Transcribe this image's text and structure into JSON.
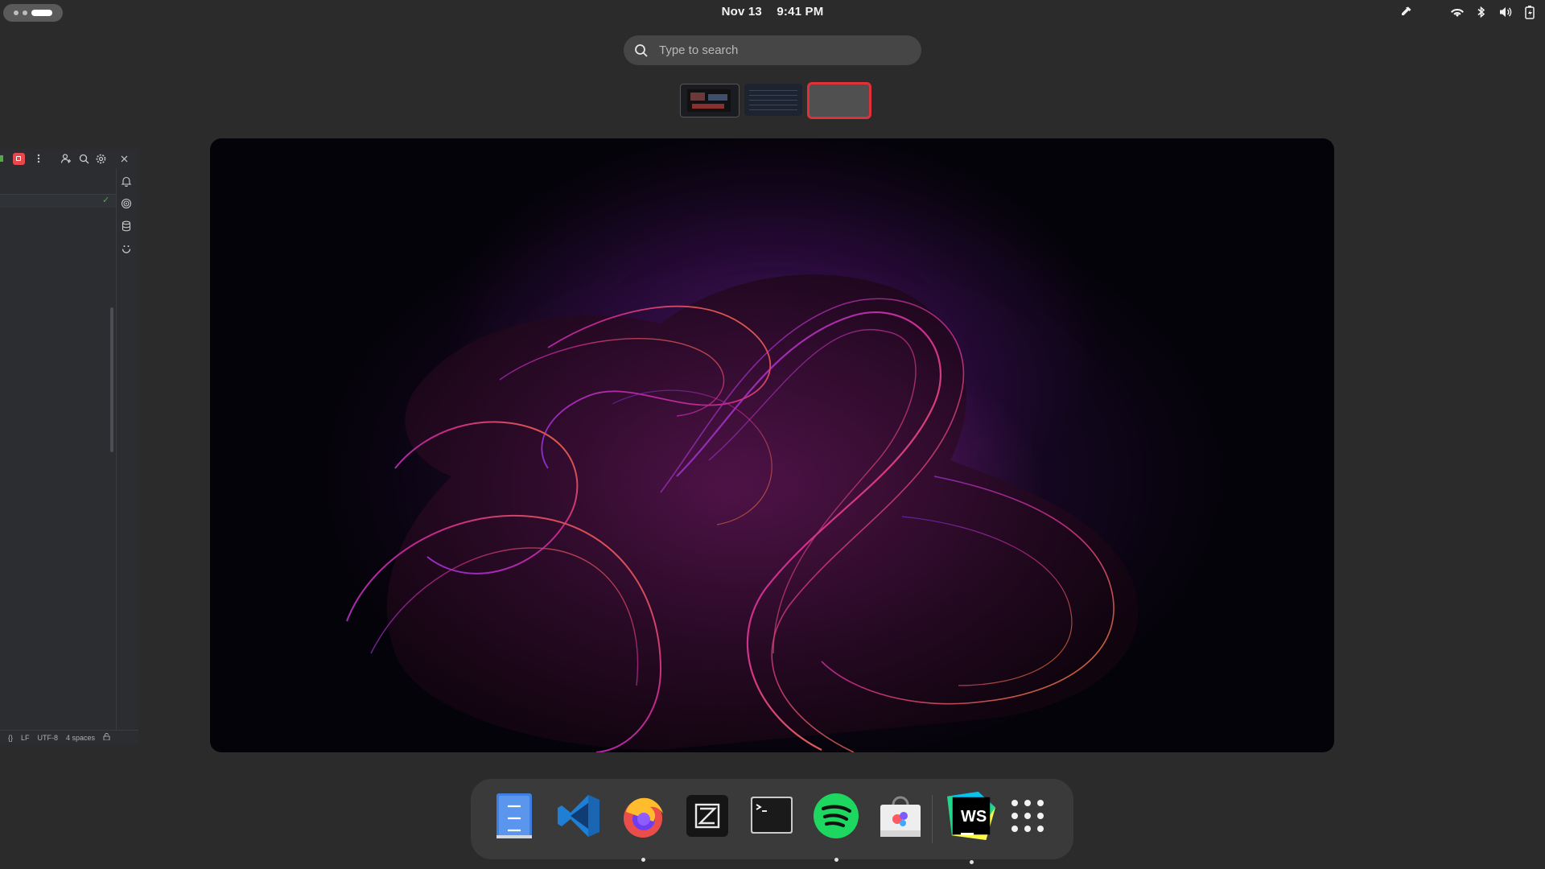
{
  "topbar": {
    "date": "Nov 13",
    "time": "9:41 PM",
    "tray_icons": [
      "color-picker-icon",
      "wifi-icon",
      "bluetooth-icon",
      "volume-icon",
      "battery-icon"
    ]
  },
  "search": {
    "placeholder": "Type to search"
  },
  "workspaces": [
    {
      "name": "workspace-1",
      "active": false
    },
    {
      "name": "workspace-2",
      "active": false
    },
    {
      "name": "workspace-3",
      "active": true
    }
  ],
  "left_window": {
    "toolbar_icons": [
      "stop-icon",
      "more-vertical-icon",
      "add-user-icon",
      "search-icon",
      "settings-icon",
      "close-icon"
    ],
    "side_icons": [
      "bell-icon",
      "spiral-icon",
      "database-icon",
      "smile-icon"
    ],
    "status": {
      "braces": "{}",
      "line_ending": "LF",
      "encoding": "UTF-8",
      "indent": "4 spaces"
    }
  },
  "dock": {
    "apps": [
      {
        "name": "Files",
        "icon": "files-icon",
        "running": false
      },
      {
        "name": "Visual Studio Code",
        "icon": "vscode-icon",
        "running": false
      },
      {
        "name": "Firefox",
        "icon": "firefox-icon",
        "running": true
      },
      {
        "name": "Zed",
        "icon": "zed-icon",
        "running": false
      },
      {
        "name": "Terminal",
        "icon": "terminal-icon",
        "running": false
      },
      {
        "name": "Spotify",
        "icon": "spotify-icon",
        "running": true
      },
      {
        "name": "Software",
        "icon": "software-store-icon",
        "running": false
      },
      {
        "name": "WebStorm",
        "icon": "webstorm-icon",
        "running": true,
        "label": "WS"
      },
      {
        "name": "Show Apps",
        "icon": "app-grid-icon",
        "running": false
      }
    ]
  },
  "colors": {
    "accent": "#e0303a",
    "background": "#2b2b2b",
    "dock": "#3a3a3a"
  }
}
